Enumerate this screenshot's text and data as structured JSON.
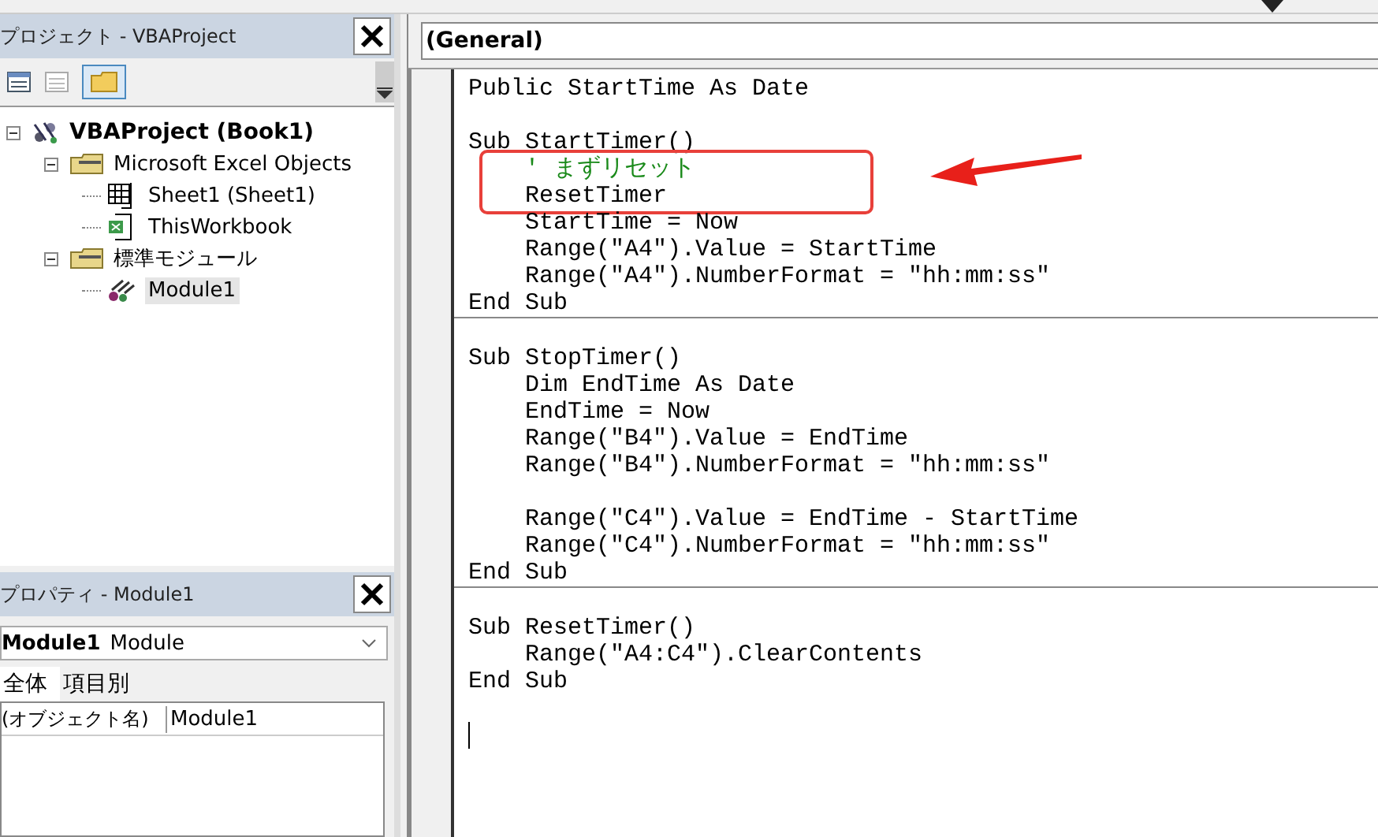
{
  "project_pane": {
    "title": "プロジェクト - VBAProject",
    "tree": [
      {
        "label": "VBAProject (Book1)",
        "kind": "project",
        "expanded": true,
        "selected": false,
        "children": [
          {
            "label": "Microsoft Excel Objects",
            "kind": "folder",
            "expanded": true,
            "selected": false,
            "children": [
              {
                "label": "Sheet1 (Sheet1)",
                "kind": "sheet",
                "selected": false
              },
              {
                "label": "ThisWorkbook",
                "kind": "workbook",
                "selected": false
              }
            ]
          },
          {
            "label": "標準モジュール",
            "kind": "folder",
            "expanded": true,
            "selected": false,
            "children": [
              {
                "label": "Module1",
                "kind": "module",
                "selected": true
              }
            ]
          }
        ]
      }
    ]
  },
  "properties_pane": {
    "title": "プロパティ - Module1",
    "object_name": "Module1",
    "object_type": "Module",
    "tabs": [
      {
        "label": "全体",
        "selected": true
      },
      {
        "label": "項目別",
        "selected": false
      }
    ],
    "rows": [
      {
        "name": "(オブジェクト名)",
        "value": "Module1"
      }
    ]
  },
  "code_pane": {
    "object_combo": "(General)",
    "procedures": [
      {
        "lines": [
          {
            "kind": "code",
            "text": "Public StartTime As Date",
            "highlighted": false
          },
          {
            "kind": "blank",
            "highlighted": false
          },
          {
            "kind": "code",
            "text": "Sub StartTimer()",
            "highlighted": false
          },
          {
            "kind": "comment",
            "text": "    ' まずリセット",
            "highlighted": true
          },
          {
            "kind": "code",
            "text": "    ResetTimer",
            "highlighted": true
          },
          {
            "kind": "code",
            "text": "    StartTime = Now",
            "highlighted": false
          },
          {
            "kind": "code",
            "text": "    Range(\"A4\").Value = StartTime",
            "highlighted": false
          },
          {
            "kind": "code",
            "text": "    Range(\"A4\").NumberFormat = \"hh:mm:ss\"",
            "highlighted": false
          },
          {
            "kind": "code",
            "text": "End Sub",
            "highlighted": false
          }
        ]
      },
      {
        "lines": [
          {
            "kind": "blank",
            "highlighted": false
          },
          {
            "kind": "code",
            "text": "Sub StopTimer()",
            "highlighted": false
          },
          {
            "kind": "code",
            "text": "    Dim EndTime As Date",
            "highlighted": false
          },
          {
            "kind": "code",
            "text": "    EndTime = Now",
            "highlighted": false
          },
          {
            "kind": "code",
            "text": "    Range(\"B4\").Value = EndTime",
            "highlighted": false
          },
          {
            "kind": "code",
            "text": "    Range(\"B4\").NumberFormat = \"hh:mm:ss\"",
            "highlighted": false
          },
          {
            "kind": "blank",
            "highlighted": false
          },
          {
            "kind": "code",
            "text": "    Range(\"C4\").Value = EndTime - StartTime",
            "highlighted": false
          },
          {
            "kind": "code",
            "text": "    Range(\"C4\").NumberFormat = \"hh:mm:ss\"",
            "highlighted": false
          },
          {
            "kind": "code",
            "text": "End Sub",
            "highlighted": false
          }
        ]
      },
      {
        "lines": [
          {
            "kind": "blank",
            "highlighted": false
          },
          {
            "kind": "code",
            "text": "Sub ResetTimer()",
            "highlighted": false
          },
          {
            "kind": "code",
            "text": "    Range(\"A4:C4\").ClearContents",
            "highlighted": false
          },
          {
            "kind": "code",
            "text": "End Sub",
            "highlighted": false
          },
          {
            "kind": "blank",
            "highlighted": false
          }
        ]
      }
    ]
  }
}
